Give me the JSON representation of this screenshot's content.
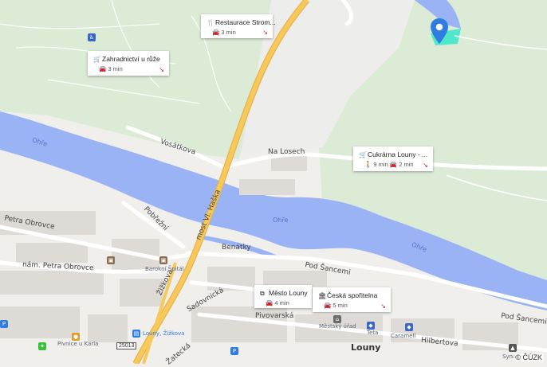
{
  "streets": {
    "petra_obrovce": "Petra Obrovce",
    "nam_petra_obrovce": "nám. Petra Obrovce",
    "pobrezni": "Pobřežní",
    "most_vl_haska": "most Vl. Haška",
    "vosatkova": "Vosátkova",
    "na_losech": "Na Losech",
    "benatky": "Benátky",
    "pod_sancemi": "Pod Šancemi",
    "pod_sancemi_2": "Pod Šancemi",
    "sadovnicka": "Sadovnická",
    "pivovarska": "Pivovarská",
    "hilbertova": "Hilbertova",
    "zizkova": "Žižkova",
    "zatecka": "Žatecká"
  },
  "rivers": {
    "ohre_1": "Ohře",
    "ohre_2": "Ohře",
    "ohre_3": "Ohře"
  },
  "places": {
    "baroka_spital": "Barokní Špitál",
    "pivnice": "Pivnice u Karla",
    "mestsky_urad": "Městský úřad",
    "teta": "Teta",
    "caramell": "Caramell",
    "louny": "Louny",
    "louny_zizkova": "Louny, Žižkova",
    "syna": "Syna",
    "road_number": "25013"
  },
  "cards": [
    {
      "title": "Restaurace Strom...",
      "icon": "fork-knife-icon",
      "icon_glyph": "🍴",
      "meta": "🚘 3 min"
    },
    {
      "title": "Zahradnictví u růže",
      "icon": "cart-icon",
      "icon_glyph": "🛒",
      "meta": "🚘 3 min"
    },
    {
      "title": "Cukrárna Louny - ...",
      "icon": "cart-icon",
      "icon_glyph": "🛒",
      "meta": "🚶 9 min   🚘 2 min"
    },
    {
      "title": "Město Louny",
      "icon": "org-chart-icon",
      "icon_glyph": "⧉",
      "meta": "🚘 4 min"
    },
    {
      "title": "Česká spořitelna",
      "icon": "bank-icon",
      "icon_glyph": "🏛",
      "meta": "🚘 5 min"
    }
  ],
  "copyright": "© ČÚZK",
  "colors": {
    "water": "#9ab3f5",
    "forest": "#dcebd6",
    "road": "#f7c95c",
    "pin": "#2f7de1",
    "parcel": "#37e8c8"
  }
}
